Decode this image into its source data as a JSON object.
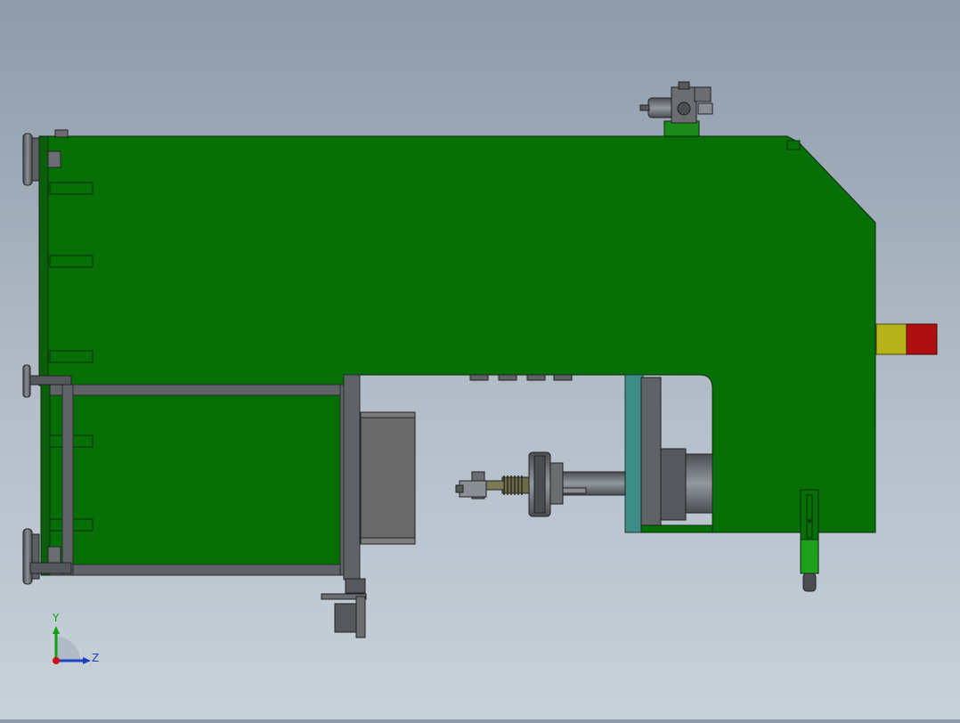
{
  "viewport": {
    "background_top": "#8d9bab",
    "background_bottom": "#c8d1da"
  },
  "model": {
    "body_color": "#067006",
    "frame_color": "#5f6367",
    "teal_plate_color": "#3e8c86",
    "yellow_cap_color": "#b5b21a",
    "red_cap_color": "#b00f12"
  },
  "triad": {
    "y_label": "Y",
    "z_label": "Z",
    "y_color": "#10a010",
    "z_color": "#1d3fc4",
    "x_color": "#d01010"
  }
}
